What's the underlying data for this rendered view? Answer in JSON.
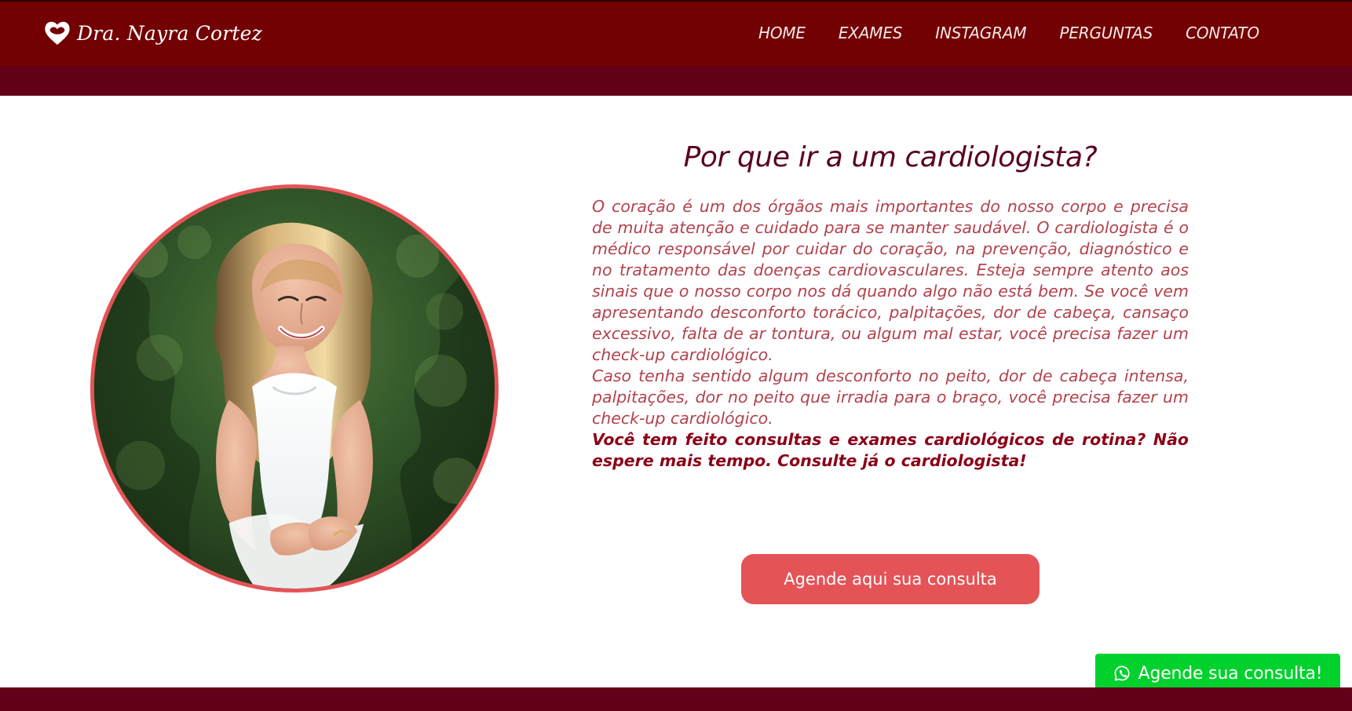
{
  "brand": {
    "name": "Dra. Nayra Cortez",
    "logo_icon": "heart-logo-icon",
    "primary_color": "#730002",
    "band_color": "#610016",
    "accent_color": "#e45457",
    "whatsapp_color": "#00d12d"
  },
  "nav": {
    "items": [
      {
        "label": "HOME"
      },
      {
        "label": "EXAMES"
      },
      {
        "label": "INSTAGRAM"
      },
      {
        "label": "PERGUNTAS"
      },
      {
        "label": "CONTATO"
      }
    ]
  },
  "main": {
    "title": "Por que ir a um cardiologista?",
    "paragraph_1": "O coração é um dos órgãos mais importantes do nosso corpo e precisa de muita atenção e cuidado para se manter saudável. O cardiologista é o médico responsável por cuidar do coração, na prevenção, diagnóstico e no tratamento das doenças cardiovasculares. Esteja sempre atento aos sinais que o nosso corpo nos dá quando algo não está bem. Se você vem apresentando desconforto torácico, palpitações, dor de cabeça, cansaço excessivo, falta de ar tontura, ou algum mal estar, você precisa fazer um check-up cardiológico.",
    "paragraph_2": "Caso tenha sentido algum desconforto no peito, dor de cabeça intensa, palpitações, dor no peito que irradia para o braço, você precisa fazer um check-up cardiológico.",
    "emphasis": "Você tem feito consultas e exames cardiológicos de rotina? Não espere mais tempo. Consulte já o cardiologista!",
    "cta_label": "Agende aqui sua consulta"
  },
  "floating": {
    "icon": "whatsapp-icon",
    "label": "Agende sua consulta!"
  }
}
